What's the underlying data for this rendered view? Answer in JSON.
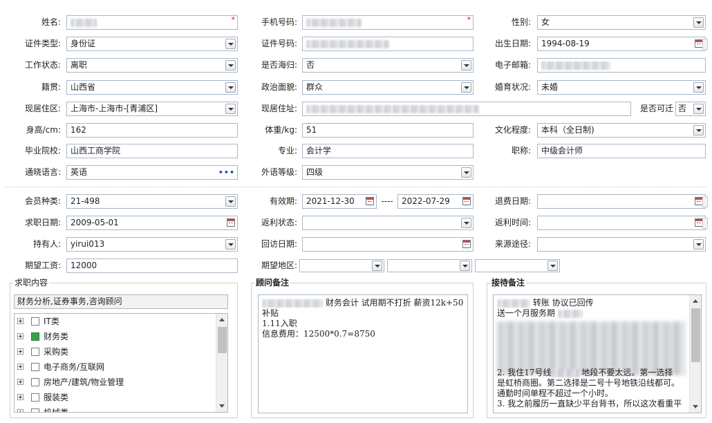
{
  "basic": {
    "name_label": "姓名:",
    "phone_label": "手机号码:",
    "gender_label": "性别:",
    "gender_value": "女",
    "idtype_label": "证件类型:",
    "idtype_value": "身份证",
    "idno_label": "证件号码:",
    "birth_label": "出生日期:",
    "birth_value": "1994-08-19",
    "workstatus_label": "工作状态:",
    "workstatus_value": "离职",
    "overseas_label": "是否海归:",
    "overseas_value": "否",
    "email_label": "电子邮箱:",
    "native_label": "籍贯:",
    "native_value": "山西省",
    "political_label": "政治面貌:",
    "political_value": "群众",
    "marital_label": "婚育状况:",
    "marital_value": "未婚",
    "residence_label": "现居住区:",
    "residence_value": "上海市-上海市-[青浦区]",
    "address_label": "现居住址:",
    "relocate_label": "是否可迁",
    "relocate_value": "否",
    "height_label": "身高/cm:",
    "height_value": "162",
    "weight_label": "体重/kg:",
    "weight_value": "51",
    "education_label": "文化程度:",
    "education_value": "本科（全日制)",
    "school_label": "毕业院校:",
    "school_value": "山西工商学院",
    "major_label": "专业:",
    "major_value": "会计学",
    "title_label": "职称:",
    "title_value": "中级会计师",
    "language_label": "通晓语言:",
    "language_value": "英语",
    "langlevel_label": "外语等级:",
    "langlevel_value": "四级"
  },
  "member": {
    "type_label": "会员种类:",
    "type_value": "21-498",
    "valid_label": "有效期:",
    "valid_from": "2021-12-30",
    "valid_sep": "----",
    "valid_to": "2022-07-29",
    "refund_label": "退费日期:",
    "apply_label": "求职日期:",
    "apply_value": "2009-05-01",
    "rebate_status_label": "返利状态:",
    "rebate_time_label": "返利时间:",
    "holder_label": "持有人:",
    "holder_value": "yirui013",
    "visit_label": "回访日期:",
    "source_label": "来源途径:",
    "salary_label": "期望工资:",
    "salary_value": "12000",
    "region_label": "期望地区:"
  },
  "job": {
    "title": "求职内容",
    "selected": "财务分析,证券事务,咨询顾问",
    "categories": [
      {
        "label": "IT类",
        "checked": false
      },
      {
        "label": "财务类",
        "checked": true
      },
      {
        "label": "采购类",
        "checked": false
      },
      {
        "label": "电子商务/互联网",
        "checked": false
      },
      {
        "label": "房地产/建筑/物业管理",
        "checked": false
      },
      {
        "label": "服装类",
        "checked": false
      },
      {
        "label": "机械类",
        "checked": false
      }
    ]
  },
  "advisor": {
    "title": "顾问备注",
    "line1": "财务会计 试用期不打折 薪资12k+500",
    "line2": "补贴",
    "line3": "1.11入职",
    "line4": "信息费用：12500*0.7=8750"
  },
  "reception": {
    "title": "接待备注",
    "line1": "转账 协议已回传",
    "line2": "送一个月服务期",
    "line3": "2. 我住17号线",
    "line3b": "地段不要太远。第一选择",
    "line4": "是虹桥商圈。第二选择是二号十号地铁沿线都可。",
    "line5": "通勤时间单程不超过一个小时。",
    "line6": "3. 我之前履历一直缺少平台背书，所以这次看重平"
  }
}
